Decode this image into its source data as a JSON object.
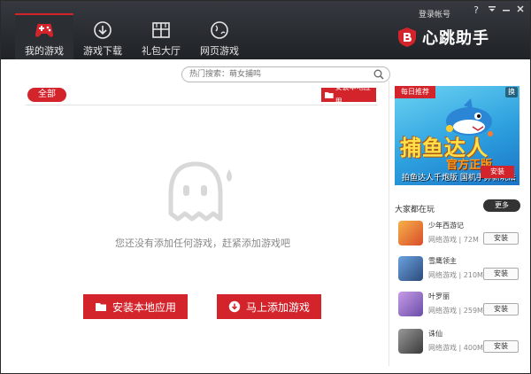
{
  "window": {
    "login_label": "登录帐号",
    "help_label": "?",
    "brand_name": "心跳助手"
  },
  "nav": {
    "tabs": [
      {
        "label": "我的游戏",
        "icon": "gamepad-icon"
      },
      {
        "label": "游戏下载",
        "icon": "download-icon"
      },
      {
        "label": "礼包大厅",
        "icon": "gift-icon"
      },
      {
        "label": "网页游戏",
        "icon": "globe-icon"
      }
    ],
    "active_index": 0
  },
  "search": {
    "placeholder": "热门搜索：萌女捕鸣"
  },
  "main": {
    "all_label": "全部",
    "install_local_small": "安装本地应用",
    "empty_message": "您还没有添加任何游戏，赶紧添加游戏吧",
    "install_local_big": "安装本地应用",
    "add_game_big": "马上添加游戏"
  },
  "daily": {
    "title": "每日推荐",
    "swap_label": "换",
    "game_title": "捕鱼达人",
    "game_sub": "官方正版",
    "promo_line": "拍鱼达人千炮版  国机手鼻新玩法",
    "install_label": "安装"
  },
  "playing": {
    "title": "大家都在玩",
    "more_label": "更多",
    "games": [
      {
        "name": "少年西游记",
        "category": "网络游戏",
        "size": "72M",
        "install": "安装",
        "color": "#d94d2a"
      },
      {
        "name": "雪鹰领主",
        "category": "网络游戏",
        "size": "210M",
        "install": "安装",
        "color": "#2c4a7a"
      },
      {
        "name": "叶罗丽",
        "category": "网络游戏",
        "size": "259M",
        "install": "安装",
        "color": "#6a4ea8"
      },
      {
        "name": "诛仙",
        "category": "网络游戏",
        "size": "400M",
        "install": "安装",
        "color": "#3a3a3a"
      }
    ]
  },
  "colors": {
    "accent": "#d3242c",
    "header_bg": "#2a2d32"
  }
}
